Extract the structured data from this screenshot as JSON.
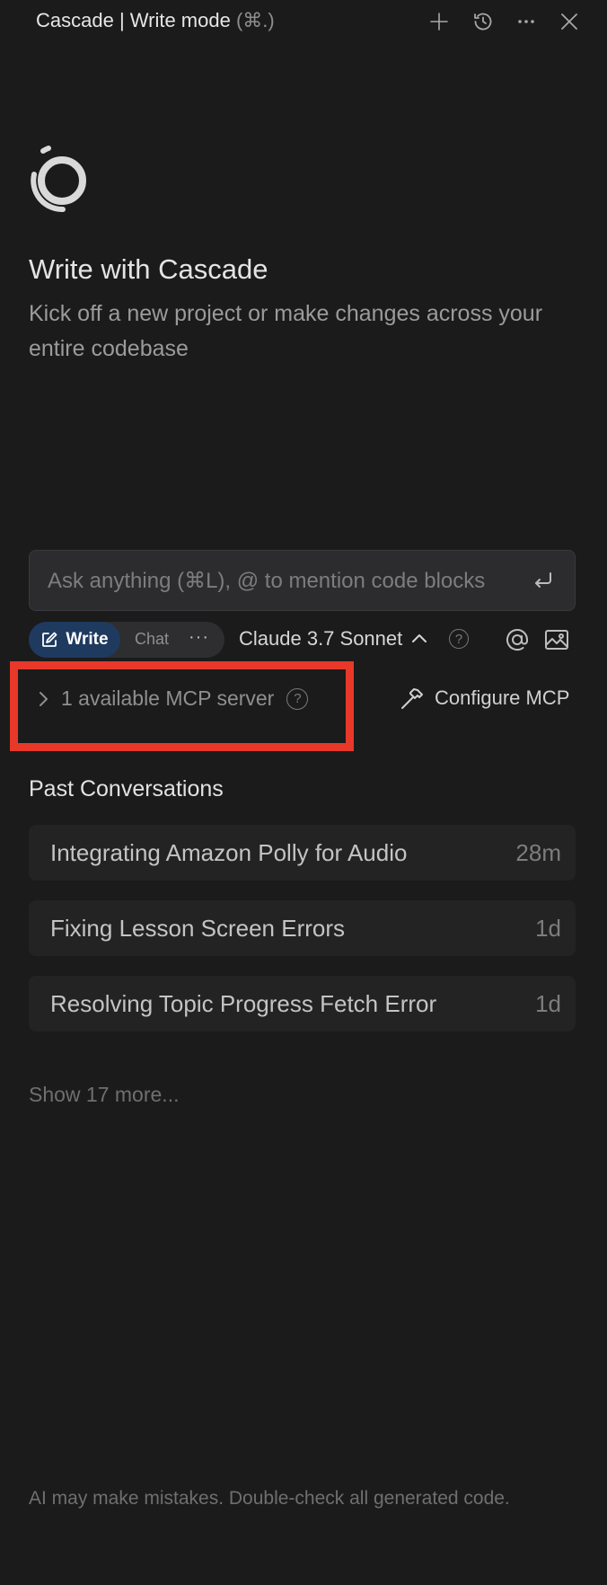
{
  "titlebar": {
    "title": "Cascade | Write mode",
    "shortcut": "(⌘.)",
    "icons": [
      "plus-icon",
      "history-icon",
      "more-icon",
      "close-icon"
    ]
  },
  "hero": {
    "heading": "Write with Cascade",
    "subheading": "Kick off a new project or make changes across your entire codebase"
  },
  "input": {
    "placeholder": "Ask anything (⌘L), @ to mention code blocks"
  },
  "toolbar": {
    "write_label": "Write",
    "chat_label": "Chat",
    "more_label": "···",
    "model": "Claude 3.7 Sonnet",
    "help": "?"
  },
  "mcp": {
    "available_label": "1 available MCP server",
    "help": "?",
    "configure_label": "Configure MCP",
    "highlight_color": "#e8382a"
  },
  "past": {
    "title": "Past Conversations",
    "items": [
      {
        "title": "Integrating Amazon Polly for Audio",
        "time": "28m"
      },
      {
        "title": "Fixing Lesson Screen Errors",
        "time": "1d"
      },
      {
        "title": "Resolving Topic Progress Fetch Error",
        "time": "1d"
      }
    ],
    "show_more": "Show 17 more..."
  },
  "footer": {
    "disclaimer": "AI may make mistakes. Double-check all generated code."
  },
  "colors": {
    "background": "#1b1b1c",
    "write_pill": "#1f3a5f",
    "highlight": "#e8382a"
  }
}
